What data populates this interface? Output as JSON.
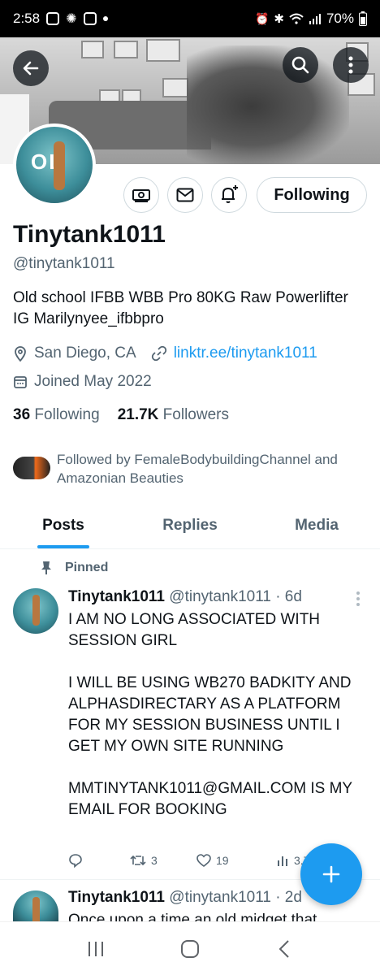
{
  "status_bar": {
    "time": "2:58",
    "battery": "70%",
    "icons": [
      "instagram-icon",
      "weather-icon",
      "gallery-icon",
      "notification-dot",
      "alarm-icon",
      "bluetooth-icon",
      "wifi-icon",
      "signal-icon",
      "battery-icon"
    ]
  },
  "header": {
    "back_icon": "arrow-left-icon",
    "search_icon": "search-icon",
    "more_icon": "more-vertical-icon"
  },
  "profile": {
    "avatar_text": "OL",
    "display_name": "Tinytank1011",
    "handle": "@tinytank1011",
    "bio": "Old school IFBB WBB Pro 80KG  Raw Powerlifter IG Marilynyee_ifbbpro",
    "location": "San Diego, CA",
    "website": "linktr.ee/tinytank1011",
    "joined": "Joined May 2022",
    "following_count": "36",
    "following_label": "Following",
    "followers_count": "21.7K",
    "followers_label": "Followers",
    "followed_by": "Followed by FemaleBodybuildingChannel and Amazonian Beauties"
  },
  "actions": {
    "subscription_icon": "money-icon",
    "message_icon": "mail-icon",
    "notify_icon": "bell-plus-icon",
    "following_button": "Following"
  },
  "tabs": [
    {
      "label": "Posts",
      "active": true
    },
    {
      "label": "Replies",
      "active": false
    },
    {
      "label": "Media",
      "active": false
    }
  ],
  "pinned_label": "Pinned",
  "tweets": [
    {
      "name": "Tinytank1011",
      "meta": "@tinytank1011 · 6d",
      "paragraphs": [
        "I AM NO LONG ASSOCIATED WITH SESSION GIRL",
        "I WILL BE USING WB270  BADKITY AND ALPHASDIRECTARY AS A PLATFORM FOR MY SESSION BUSINESS UNTIL I GET MY OWN SITE RUNNING",
        "MMTINYTANK1011@GMAIL.COM IS MY EMAIL FOR BOOKING"
      ],
      "replies": "",
      "retweets": "3",
      "likes": "19",
      "views": "3.7K"
    },
    {
      "name": "Tinytank1011",
      "meta": "@tinytank1011 · 2d",
      "text": "Once upon a time an old midget that"
    }
  ],
  "fab_icon": "plus-icon",
  "nav": {
    "recents_icon": "recents-icon",
    "home_icon": "home-circle-icon",
    "back_icon": "back-chevron-icon"
  },
  "colors": {
    "accent": "#1d9bf0",
    "text_primary": "#0f1419",
    "text_secondary": "#536471"
  }
}
